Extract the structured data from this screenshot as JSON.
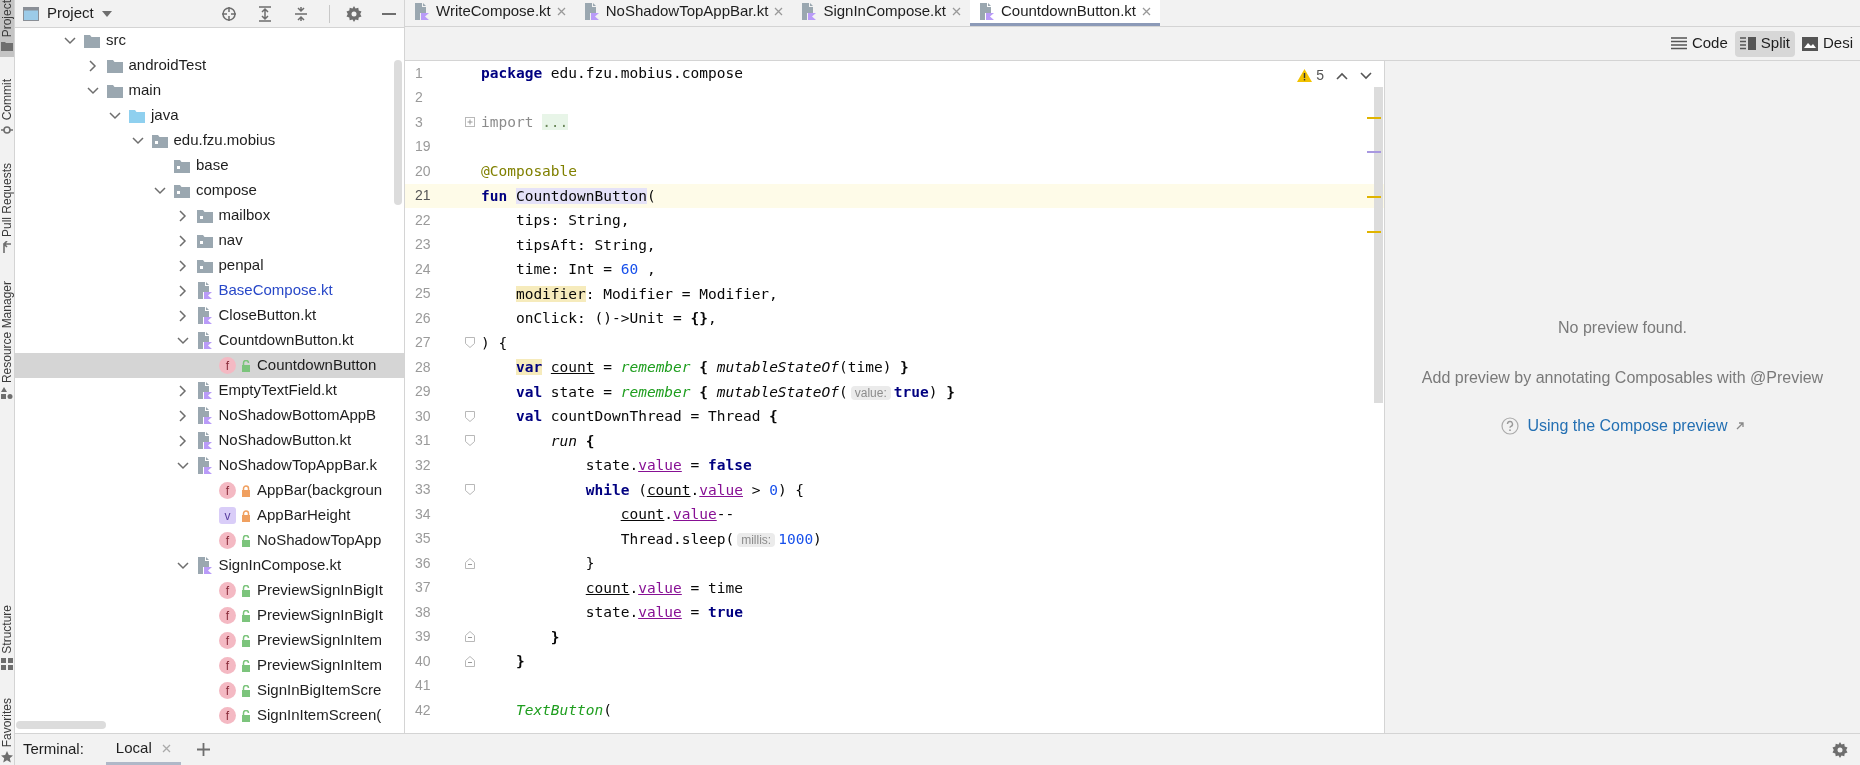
{
  "tool_strip": {
    "top": [
      {
        "label": "Project",
        "selected": true
      },
      {
        "label": "Commit",
        "selected": false
      },
      {
        "label": "Pull Requests",
        "selected": false
      },
      {
        "label": "Resource Manager",
        "selected": false
      }
    ],
    "bottom": [
      {
        "label": "Structure",
        "selected": false
      },
      {
        "label": "Favorites",
        "selected": false
      }
    ]
  },
  "project_panel": {
    "title": "Project",
    "tree": [
      {
        "label": "src",
        "kind": "folder",
        "expanded": true,
        "selected": false,
        "modified": false,
        "children": [
          {
            "label": "androidTest",
            "kind": "folder",
            "expanded": false,
            "selected": false,
            "modified": false
          },
          {
            "label": "main",
            "kind": "folder",
            "expanded": true,
            "selected": false,
            "modified": false,
            "children": [
              {
                "label": "java",
                "kind": "source-folder",
                "expanded": true,
                "selected": false,
                "modified": false,
                "children": [
                  {
                    "label": "edu.fzu.mobius",
                    "kind": "package",
                    "expanded": true,
                    "selected": false,
                    "modified": false,
                    "children": [
                      {
                        "label": "base",
                        "kind": "package",
                        "selected": false,
                        "modified": false
                      },
                      {
                        "label": "compose",
                        "kind": "package",
                        "expanded": true,
                        "selected": false,
                        "modified": false,
                        "children": [
                          {
                            "label": "mailbox",
                            "kind": "package",
                            "expanded": false,
                            "selected": false,
                            "modified": false
                          },
                          {
                            "label": "nav",
                            "kind": "package",
                            "expanded": false,
                            "selected": false,
                            "modified": false
                          },
                          {
                            "label": "penpal",
                            "kind": "package",
                            "expanded": false,
                            "selected": false,
                            "modified": false
                          },
                          {
                            "label": "BaseCompose.kt",
                            "kind": "kotlin-file",
                            "expanded": false,
                            "selected": false,
                            "modified": true
                          },
                          {
                            "label": "CloseButton.kt",
                            "kind": "kotlin-file",
                            "expanded": false,
                            "selected": false,
                            "modified": false
                          },
                          {
                            "label": "CountdownButton.kt",
                            "kind": "kotlin-file",
                            "expanded": true,
                            "selected": false,
                            "modified": false,
                            "children": [
                              {
                                "label": "CountdownButton",
                                "kind": "function",
                                "symbol": "f",
                                "private": false,
                                "selected": true,
                                "modified": false
                              }
                            ]
                          },
                          {
                            "label": "EmptyTextField.kt",
                            "kind": "kotlin-file",
                            "expanded": false,
                            "selected": false,
                            "modified": false
                          },
                          {
                            "label": "NoShadowBottomAppB",
                            "kind": "kotlin-file",
                            "expanded": false,
                            "selected": false,
                            "modified": false
                          },
                          {
                            "label": "NoShadowButton.kt",
                            "kind": "kotlin-file",
                            "expanded": false,
                            "selected": false,
                            "modified": false
                          },
                          {
                            "label": "NoShadowTopAppBar.k",
                            "kind": "kotlin-file",
                            "expanded": true,
                            "selected": false,
                            "modified": false,
                            "children": [
                              {
                                "label": "AppBar(backgroun",
                                "kind": "function",
                                "symbol": "f",
                                "private": true,
                                "selected": false,
                                "modified": false
                              },
                              {
                                "label": "AppBarHeight",
                                "kind": "property",
                                "symbol": "v",
                                "private": true,
                                "selected": false,
                                "modified": false
                              },
                              {
                                "label": "NoShadowTopApp",
                                "kind": "function",
                                "symbol": "f",
                                "private": false,
                                "selected": false,
                                "modified": false
                              }
                            ]
                          },
                          {
                            "label": "SignInCompose.kt",
                            "kind": "kotlin-file",
                            "expanded": true,
                            "selected": false,
                            "modified": false,
                            "children": [
                              {
                                "label": "PreviewSignInBigIt",
                                "kind": "function",
                                "symbol": "f",
                                "private": false,
                                "selected": false,
                                "modified": false
                              },
                              {
                                "label": "PreviewSignInBigIt",
                                "kind": "function",
                                "symbol": "f",
                                "private": false,
                                "selected": false,
                                "modified": false
                              },
                              {
                                "label": "PreviewSignInItem",
                                "kind": "function",
                                "symbol": "f",
                                "private": false,
                                "selected": false,
                                "modified": false
                              },
                              {
                                "label": "PreviewSignInItem",
                                "kind": "function",
                                "symbol": "f",
                                "private": false,
                                "selected": false,
                                "modified": false
                              },
                              {
                                "label": "SignInBigItemScre",
                                "kind": "function",
                                "symbol": "f",
                                "private": false,
                                "selected": false,
                                "modified": false
                              },
                              {
                                "label": "SignInItemScreen(",
                                "kind": "function",
                                "symbol": "f",
                                "private": false,
                                "selected": false,
                                "modified": false
                              }
                            ]
                          }
                        ]
                      }
                    ]
                  }
                ]
              }
            ]
          }
        ]
      }
    ]
  },
  "tabs": [
    {
      "label": "WriteCompose.kt",
      "selected": false
    },
    {
      "label": "NoShadowTopAppBar.kt",
      "selected": false
    },
    {
      "label": "SignInCompose.kt",
      "selected": false
    },
    {
      "label": "CountdownButton.kt",
      "selected": true
    }
  ],
  "view_modes": [
    {
      "label": "Code",
      "selected": false
    },
    {
      "label": "Split",
      "selected": true
    },
    {
      "label": "Desi",
      "selected": false
    }
  ],
  "editor": {
    "warning_count": "5",
    "lines": [
      {
        "number": "1",
        "current": false,
        "tokens": [
          {
            "text": "package",
            "kind": "kw"
          },
          {
            "text": " edu.fzu.mobius.compose",
            "kind": "p"
          }
        ]
      },
      {
        "number": "2",
        "current": false
      },
      {
        "number": "3",
        "current": false,
        "marker": {
          "kind": "collapsed"
        },
        "tokens": [
          {
            "text": "import",
            "kind": "gray"
          },
          {
            "text": " ...",
            "kind": "fold"
          }
        ]
      },
      {
        "number": "19",
        "current": false
      },
      {
        "number": "20",
        "current": false,
        "tokens": [
          {
            "text": "@Composable",
            "kind": "ann"
          }
        ]
      },
      {
        "number": "21",
        "current": true,
        "tokens": [
          {
            "text": "fun",
            "kind": "kw"
          },
          {
            "text": " CountdownButton",
            "kind": "decl"
          },
          {
            "text": "(",
            "kind": "p"
          }
        ]
      },
      {
        "number": "22",
        "current": false,
        "tokens": [
          {
            "text": "    tips: String,",
            "kind": "p"
          }
        ]
      },
      {
        "number": "23",
        "current": false,
        "tokens": [
          {
            "text": "    tipsAft: String,",
            "kind": "p"
          }
        ]
      },
      {
        "number": "24",
        "current": false,
        "tokens": [
          {
            "text": "    time: Int = ",
            "kind": "p"
          },
          {
            "text": "60",
            "kind": "num"
          },
          {
            "text": " ,",
            "kind": "p"
          }
        ]
      },
      {
        "number": "25",
        "current": false,
        "tokens": [
          {
            "text": "    modifier",
            "kind": "warn"
          },
          {
            "text": ": Modifier = Modifier,",
            "kind": "p"
          }
        ]
      },
      {
        "number": "26",
        "current": false,
        "tokens": [
          {
            "text": "    onClick: ()->Unit = ",
            "kind": "p"
          },
          {
            "text": "{}",
            "kind": "bold"
          },
          {
            "text": ",",
            "kind": "p"
          }
        ]
      },
      {
        "number": "27",
        "current": false,
        "marker": {
          "kind": "start"
        },
        "tokens": [
          {
            "text": ") {",
            "kind": "p"
          }
        ]
      },
      {
        "number": "28",
        "current": false,
        "tokens": [
          {
            "text": "    var",
            "kind": "kwwarn"
          },
          {
            "text": " count",
            "kind": "under"
          },
          {
            "text": " = ",
            "kind": "p"
          },
          {
            "text": "remember",
            "kind": "green"
          },
          {
            "text": " {",
            "kind": "bold"
          },
          {
            "text": " mutableStateOf",
            "kind": "italic"
          },
          {
            "text": "(time) ",
            "kind": "p"
          },
          {
            "text": "}",
            "kind": "bold"
          }
        ]
      },
      {
        "number": "29",
        "current": false,
        "tokens": [
          {
            "text": "    val",
            "kind": "kw"
          },
          {
            "text": " state = ",
            "kind": "p"
          },
          {
            "text": "remember",
            "kind": "green"
          },
          {
            "text": " {",
            "kind": "bold"
          },
          {
            "text": " mutableStateOf",
            "kind": "italic"
          },
          {
            "text": "(",
            "kind": "p"
          },
          {
            "text": "value:",
            "kind": "hint"
          },
          {
            "text": "true",
            "kind": "kw"
          },
          {
            "text": ") ",
            "kind": "p"
          },
          {
            "text": "}",
            "kind": "bold"
          }
        ]
      },
      {
        "number": "30",
        "current": false,
        "marker": {
          "kind": "start"
        },
        "tokens": [
          {
            "text": "    val",
            "kind": "kw"
          },
          {
            "text": " countDownThread = Thread ",
            "kind": "p"
          },
          {
            "text": "{",
            "kind": "bold"
          }
        ]
      },
      {
        "number": "31",
        "current": false,
        "marker": {
          "kind": "start"
        },
        "tokens": [
          {
            "text": "        run",
            "kind": "italic"
          },
          {
            "text": " {",
            "kind": "bold"
          }
        ]
      },
      {
        "number": "32",
        "current": false,
        "tokens": [
          {
            "text": "            state.",
            "kind": "p"
          },
          {
            "text": "value",
            "kind": "prop"
          },
          {
            "text": " = ",
            "kind": "p"
          },
          {
            "text": "false",
            "kind": "kw"
          }
        ]
      },
      {
        "number": "33",
        "current": false,
        "marker": {
          "kind": "start"
        },
        "tokens": [
          {
            "text": "            while",
            "kind": "kw"
          },
          {
            "text": " (",
            "kind": "p"
          },
          {
            "text": "count",
            "kind": "under"
          },
          {
            "text": ".",
            "kind": "p"
          },
          {
            "text": "value",
            "kind": "prop"
          },
          {
            "text": " > ",
            "kind": "p"
          },
          {
            "text": "0",
            "kind": "num"
          },
          {
            "text": ") {",
            "kind": "p"
          }
        ]
      },
      {
        "number": "34",
        "current": false,
        "tokens": [
          {
            "text": "                count",
            "kind": "under"
          },
          {
            "text": ".",
            "kind": "p"
          },
          {
            "text": "value",
            "kind": "prop"
          },
          {
            "text": "--",
            "kind": "p"
          }
        ]
      },
      {
        "number": "35",
        "current": false,
        "tokens": [
          {
            "text": "                Thread.sleep(",
            "kind": "p"
          },
          {
            "text": "millis:",
            "kind": "hint"
          },
          {
            "text": "1000",
            "kind": "num"
          },
          {
            "text": ")",
            "kind": "p"
          }
        ]
      },
      {
        "number": "36",
        "current": false,
        "marker": {
          "kind": "end"
        },
        "tokens": [
          {
            "text": "            }",
            "kind": "p"
          }
        ]
      },
      {
        "number": "37",
        "current": false,
        "tokens": [
          {
            "text": "            count",
            "kind": "under"
          },
          {
            "text": ".",
            "kind": "p"
          },
          {
            "text": "value",
            "kind": "prop"
          },
          {
            "text": " = time",
            "kind": "p"
          }
        ]
      },
      {
        "number": "38",
        "current": false,
        "tokens": [
          {
            "text": "            state.",
            "kind": "p"
          },
          {
            "text": "value",
            "kind": "prop"
          },
          {
            "text": " = ",
            "kind": "p"
          },
          {
            "text": "true",
            "kind": "kw"
          }
        ]
      },
      {
        "number": "39",
        "current": false,
        "marker": {
          "kind": "end"
        },
        "tokens": [
          {
            "text": "        }",
            "kind": "bold"
          }
        ]
      },
      {
        "number": "40",
        "current": false,
        "marker": {
          "kind": "end"
        },
        "tokens": [
          {
            "text": "    }",
            "kind": "bold"
          }
        ]
      },
      {
        "number": "41",
        "current": false
      },
      {
        "number": "42",
        "current": false,
        "tokens": [
          {
            "text": "    TextButton",
            "kind": "green"
          },
          {
            "text": "(",
            "kind": "p"
          }
        ]
      }
    ]
  },
  "preview": {
    "message": "No preview found.",
    "hint": "Add preview by annotating Composables with @Preview",
    "link": "Using the Compose preview"
  },
  "bottom_bar": {
    "label": "Terminal:",
    "tabs": [
      {
        "label": "Local",
        "selected": true
      }
    ]
  }
}
